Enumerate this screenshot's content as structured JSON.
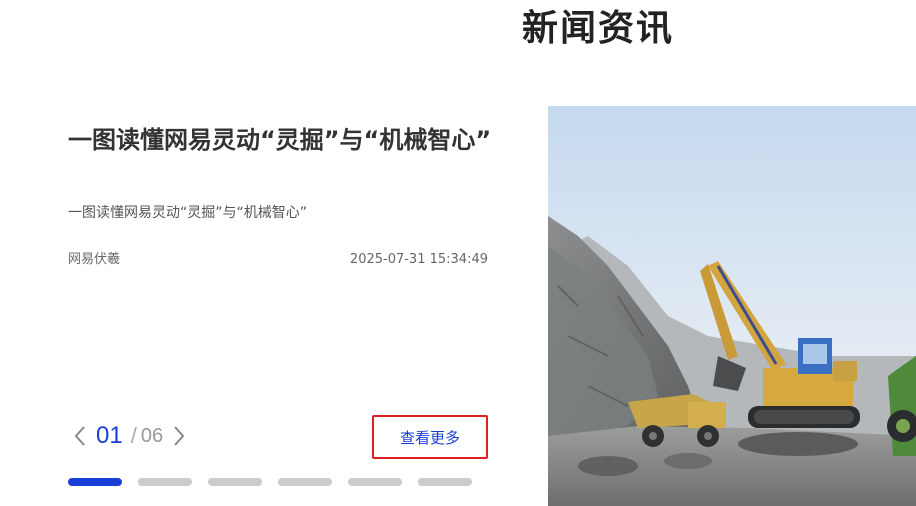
{
  "section": {
    "title": "新闻资讯"
  },
  "article": {
    "title": "一图读懂网易灵动“灵掘”与“机械智心”",
    "summary": "一图读懂网易灵动“灵掘”与“机械智心”",
    "source": "网易伏羲",
    "date": "2025-07-31 15:34:49",
    "image_alt": "excavator-in-quarry"
  },
  "pager": {
    "current": "01",
    "separator": "/",
    "total": "06",
    "prev_icon": "chevron-left-icon",
    "next_icon": "chevron-right-icon",
    "more_label": "查看更多",
    "slides_count": 6,
    "active_index": 0
  },
  "colors": {
    "accent": "#1a3fd9",
    "highlight_border": "#e02020",
    "inactive_dot": "#cccccc"
  }
}
